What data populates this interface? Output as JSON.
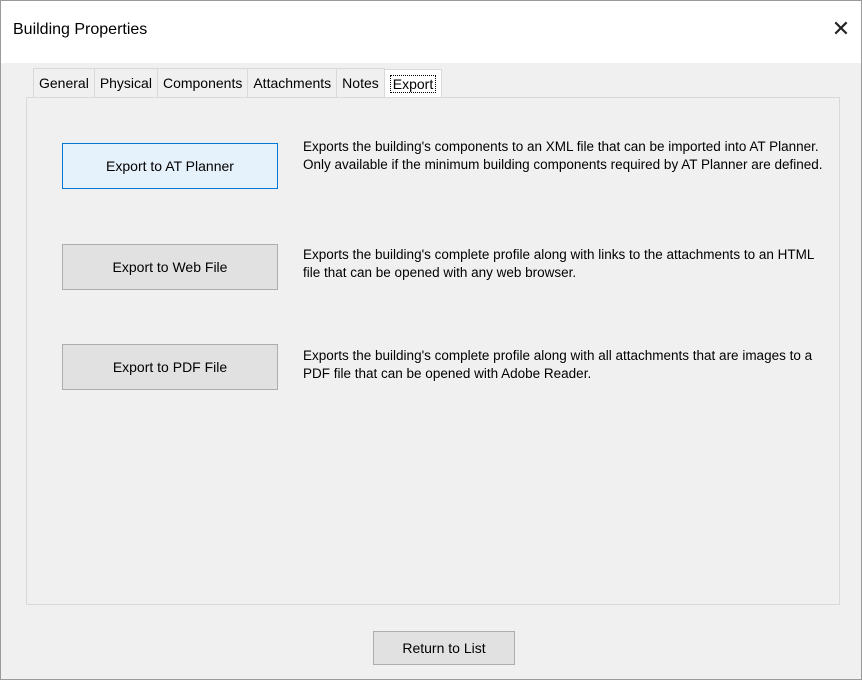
{
  "window": {
    "title": "Building Properties",
    "close_glyph": "✕"
  },
  "tabs": [
    {
      "label": "General",
      "active": false
    },
    {
      "label": "Physical",
      "active": false
    },
    {
      "label": "Components",
      "active": false
    },
    {
      "label": "Attachments",
      "active": false
    },
    {
      "label": "Notes",
      "active": false
    },
    {
      "label": "Export",
      "active": true
    }
  ],
  "export": {
    "at_planner": {
      "button_label": "Export to AT Planner",
      "description": "Exports the building's components to an XML file that can be imported into AT Planner. Only available if the minimum building components required by AT Planner are defined."
    },
    "web_file": {
      "button_label": "Export to Web File",
      "description": "Exports the building's complete profile along with links to the attachments to an HTML file that can be opened with any web browser."
    },
    "pdf_file": {
      "button_label": "Export to PDF File",
      "description": "Exports the building's complete profile along with all attachments that are images to a PDF file that can be opened with Adobe Reader."
    }
  },
  "footer": {
    "return_label": "Return to List"
  },
  "colors": {
    "window_bg": "#f0f0f0",
    "titlebar_bg": "#ffffff",
    "focus_border": "#0078d7",
    "focus_bg": "#e5f1fb",
    "button_bg": "#e1e1e1"
  },
  "icons": {
    "close": "close-icon"
  }
}
